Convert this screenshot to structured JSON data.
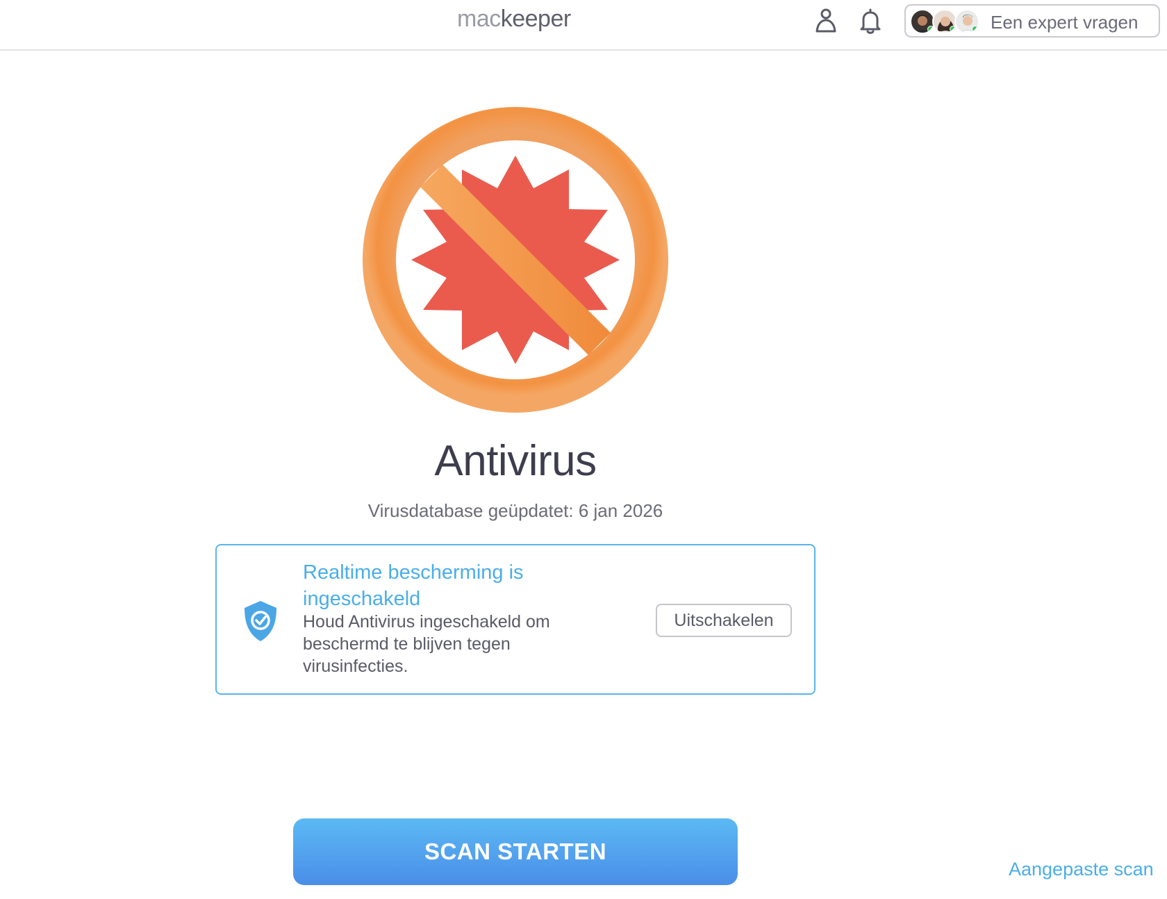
{
  "header": {
    "logo_mac": "mac",
    "logo_keeper": "keeper",
    "expert_button_label": "Een expert vragen",
    "icons": [
      "account-icon",
      "bell-icon"
    ]
  },
  "hero": {
    "illustration": "virus-blocked-icon",
    "title": "Antivirus",
    "subtitle": "Virusdatabase geüpdatet: 6 jan 2026"
  },
  "protection_card": {
    "icon": "shield-check-icon",
    "title": "Realtime bescherming is ingeschakeld",
    "description": "Houd Antivirus ingeschakeld om beschermd te blijven tegen virusinfecties.",
    "disable_button_label": "Uitschakelen"
  },
  "actions": {
    "scan_button_label": "SCAN STARTEN",
    "custom_scan_link": "Aangepaste scan"
  },
  "colors": {
    "accent": "#4aaee8",
    "scan_gradient_top": "#5cb9f4",
    "scan_gradient_bottom": "#4a8ee8",
    "prohibit_orange": "#f29a4a",
    "virus_red": "#ea5b4e"
  }
}
